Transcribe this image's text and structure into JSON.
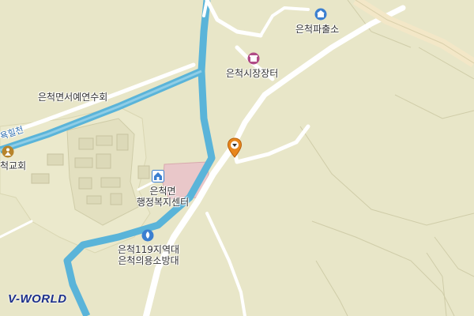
{
  "map": {
    "colors": {
      "land": "#e8e6c8",
      "village": "#f0edd0",
      "road": "#ffffff",
      "river": "#5ab4d9",
      "pink_area": "#e9c7c9",
      "marker": "#e8861c",
      "brand": "#1c2f8a"
    },
    "labels": {
      "police_box": "은척파출소",
      "market": "은척시장장터",
      "elders_club": "은척면서예연수회",
      "river": "욕힐천",
      "church": "척교회",
      "admin_center_line1": "은척면",
      "admin_center_line2": "행정복지센터",
      "fire_line1": "은척119지역대",
      "fire_line2": "은척의용소방대"
    },
    "icons": {
      "police_box": "police-icon",
      "market": "market-icon",
      "church": "church-icon",
      "admin_center": "government-office-icon",
      "fire": "fire-station-icon",
      "marker": "location-pin-icon"
    },
    "brand": "V-WORLD"
  }
}
